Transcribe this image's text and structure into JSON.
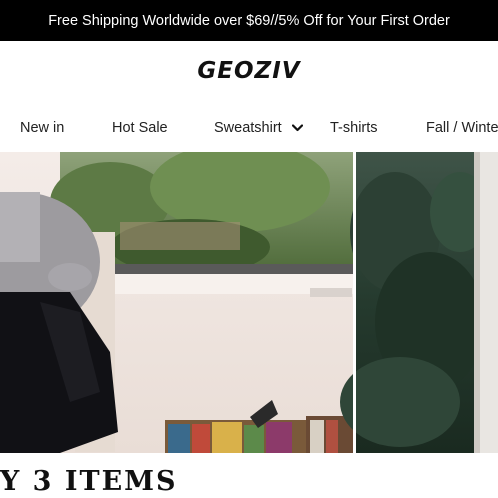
{
  "announcement": {
    "text": "Free Shipping Worldwide over $69//5% Off for Your First Order"
  },
  "brand": {
    "logo_text": "GEOZIV"
  },
  "nav": {
    "items": [
      {
        "label": "New in"
      },
      {
        "label": "Hot Sale"
      },
      {
        "label": "Sweatshirt",
        "icon": "chevron-down-icon"
      },
      {
        "label": "T-shirts"
      },
      {
        "label": "Fall / Winte"
      }
    ]
  },
  "promo": {
    "headline": "Y 3 ITEMS"
  },
  "colors": {
    "announcement_bg": "#000000",
    "text": "#111111",
    "background": "#ffffff"
  }
}
